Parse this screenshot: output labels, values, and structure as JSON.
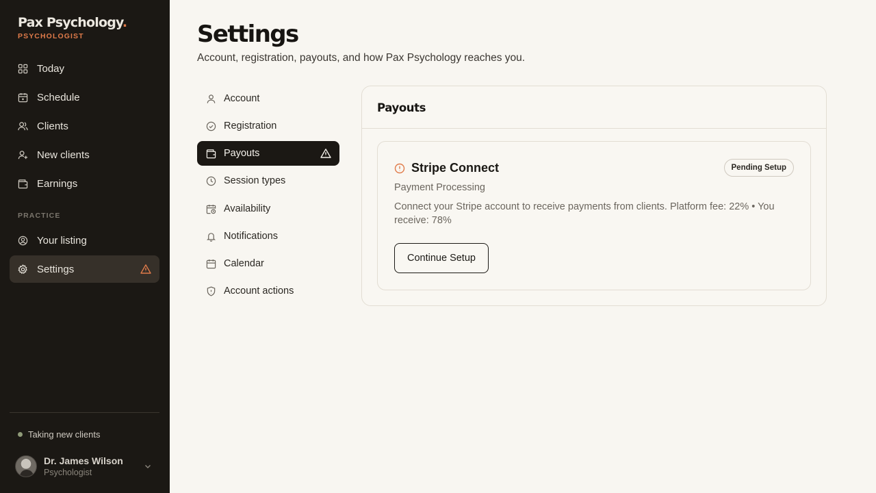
{
  "brand": {
    "name": "Pax Psychology",
    "dot": ".",
    "role": "PSYCHOLOGIST"
  },
  "sidebar": {
    "items": [
      {
        "label": "Today",
        "icon": "grid-icon"
      },
      {
        "label": "Schedule",
        "icon": "calendar-icon"
      },
      {
        "label": "Clients",
        "icon": "users-icon"
      },
      {
        "label": "New clients",
        "icon": "user-plus-icon"
      },
      {
        "label": "Earnings",
        "icon": "wallet-icon"
      }
    ],
    "section_label": "PRACTICE",
    "practice_items": [
      {
        "label": "Your listing",
        "icon": "user-circle-icon"
      },
      {
        "label": "Settings",
        "icon": "gear-icon",
        "active": true,
        "warning": true
      }
    ],
    "status": "Taking new clients",
    "profile": {
      "name": "Dr. James Wilson",
      "role": "Psychologist"
    }
  },
  "page": {
    "title": "Settings",
    "subtitle": "Account, registration, payouts, and how Pax Psychology reaches you."
  },
  "subnav": {
    "items": [
      {
        "label": "Account",
        "icon": "user-icon"
      },
      {
        "label": "Registration",
        "icon": "check-circle-icon"
      },
      {
        "label": "Payouts",
        "icon": "wallet-icon",
        "active": true,
        "warning": true
      },
      {
        "label": "Session types",
        "icon": "clock-icon"
      },
      {
        "label": "Availability",
        "icon": "calendar-clock-icon"
      },
      {
        "label": "Notifications",
        "icon": "bell-icon"
      },
      {
        "label": "Calendar",
        "icon": "calendar-icon"
      },
      {
        "label": "Account actions",
        "icon": "shield-icon"
      }
    ]
  },
  "panel": {
    "title": "Payouts",
    "card": {
      "title": "Stripe Connect",
      "badge": "Pending Setup",
      "subtitle": "Payment Processing",
      "description": "Connect your Stripe account to receive payments from clients. Platform fee: 22% • You receive: 78%",
      "button": "Continue Setup"
    }
  },
  "colors": {
    "accent": "#e07b4a",
    "sidebar_bg": "#1b1814",
    "page_bg": "#f8f6f1",
    "status_dot": "#8f9a78"
  }
}
